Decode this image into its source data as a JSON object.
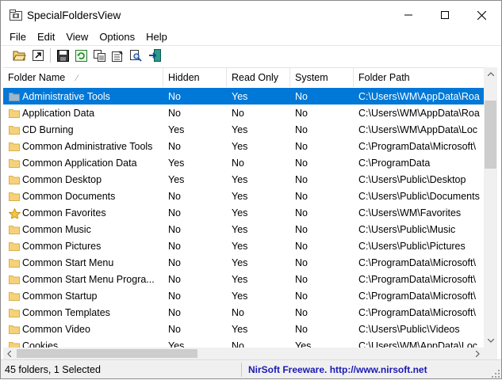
{
  "window": {
    "title": "SpecialFoldersView",
    "icon": "app-folder-icon"
  },
  "menu": [
    {
      "label": "File"
    },
    {
      "label": "Edit"
    },
    {
      "label": "View"
    },
    {
      "label": "Options"
    },
    {
      "label": "Help"
    }
  ],
  "toolbar": {
    "buttons": [
      "open-folder-icon",
      "shortcut-icon",
      "save-icon",
      "refresh-icon",
      "copy-icon",
      "properties-icon",
      "find-icon",
      "exit-icon"
    ]
  },
  "table": {
    "headers": {
      "name": "Folder Name",
      "hidden": "Hidden",
      "read_only": "Read Only",
      "system": "System",
      "path": "Folder Path"
    },
    "sorted_column": "name",
    "rows": [
      {
        "name": "Administrative Tools",
        "hidden": "No",
        "read_only": "Yes",
        "system": "No",
        "path": "C:\\Users\\WM\\AppData\\Roa",
        "icon": "folder-icon",
        "selected": true
      },
      {
        "name": "Application Data",
        "hidden": "No",
        "read_only": "No",
        "system": "No",
        "path": "C:\\Users\\WM\\AppData\\Roa",
        "icon": "folder-icon"
      },
      {
        "name": "CD Burning",
        "hidden": "Yes",
        "read_only": "Yes",
        "system": "No",
        "path": "C:\\Users\\WM\\AppData\\Loc",
        "icon": "folder-icon"
      },
      {
        "name": "Common Administrative Tools",
        "hidden": "No",
        "read_only": "Yes",
        "system": "No",
        "path": "C:\\ProgramData\\Microsoft\\",
        "icon": "folder-icon"
      },
      {
        "name": "Common Application Data",
        "hidden": "Yes",
        "read_only": "No",
        "system": "No",
        "path": "C:\\ProgramData",
        "icon": "folder-icon"
      },
      {
        "name": "Common Desktop",
        "hidden": "Yes",
        "read_only": "Yes",
        "system": "No",
        "path": "C:\\Users\\Public\\Desktop",
        "icon": "folder-icon"
      },
      {
        "name": "Common Documents",
        "hidden": "No",
        "read_only": "Yes",
        "system": "No",
        "path": "C:\\Users\\Public\\Documents",
        "icon": "folder-icon"
      },
      {
        "name": "Common Favorites",
        "hidden": "No",
        "read_only": "Yes",
        "system": "No",
        "path": "C:\\Users\\WM\\Favorites",
        "icon": "favorites-star-icon"
      },
      {
        "name": "Common Music",
        "hidden": "No",
        "read_only": "Yes",
        "system": "No",
        "path": "C:\\Users\\Public\\Music",
        "icon": "folder-icon"
      },
      {
        "name": "Common Pictures",
        "hidden": "No",
        "read_only": "Yes",
        "system": "No",
        "path": "C:\\Users\\Public\\Pictures",
        "icon": "folder-icon"
      },
      {
        "name": "Common Start Menu",
        "hidden": "No",
        "read_only": "Yes",
        "system": "No",
        "path": "C:\\ProgramData\\Microsoft\\",
        "icon": "folder-icon"
      },
      {
        "name": "Common Start Menu Progra...",
        "hidden": "No",
        "read_only": "Yes",
        "system": "No",
        "path": "C:\\ProgramData\\Microsoft\\",
        "icon": "folder-icon"
      },
      {
        "name": "Common Startup",
        "hidden": "No",
        "read_only": "Yes",
        "system": "No",
        "path": "C:\\ProgramData\\Microsoft\\",
        "icon": "folder-icon"
      },
      {
        "name": "Common Templates",
        "hidden": "No",
        "read_only": "No",
        "system": "No",
        "path": "C:\\ProgramData\\Microsoft\\",
        "icon": "folder-icon"
      },
      {
        "name": "Common Video",
        "hidden": "No",
        "read_only": "Yes",
        "system": "No",
        "path": "C:\\Users\\Public\\Videos",
        "icon": "folder-icon"
      },
      {
        "name": "Cookies",
        "hidden": "Yes",
        "read_only": "No",
        "system": "Yes",
        "path": "C:\\Users\\WM\\AppData\\Loc",
        "icon": "folder-icon"
      }
    ]
  },
  "status": {
    "summary": "45 folders, 1 Selected",
    "link": "NirSoft Freeware.  http://www.nirsoft.net"
  },
  "colors": {
    "selection": "#0078d7",
    "folder": "#f5d27a",
    "link": "#1a1ab4"
  }
}
